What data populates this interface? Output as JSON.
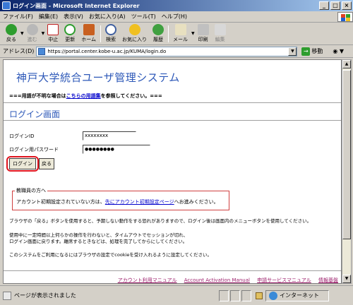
{
  "window": {
    "title": "ログイン画面 - Microsoft Internet Explorer"
  },
  "menu": [
    "ファイル(F)",
    "編集(E)",
    "表示(V)",
    "お気に入り(A)",
    "ツール(T)",
    "ヘルプ(H)"
  ],
  "toolbar": {
    "back": "戻る",
    "forward": "進む",
    "stop": "中止",
    "refresh": "更新",
    "home": "ホーム",
    "search": "検索",
    "favorites": "お気に入り",
    "history": "履歴",
    "mail": "メール",
    "print": "印刷",
    "edit": "編集"
  },
  "address": {
    "label": "アドレス(D)",
    "url": "https://portal.center.kobe-u.ac.jp/KUMA/login.do",
    "go": "移動"
  },
  "page": {
    "system_title": "神戸大学統合ユーザ管理システム",
    "notice_prefix": "===用語が不明な場合は",
    "notice_link": "こちらの用語集",
    "notice_suffix": "を参照してください。===",
    "login_heading": "ログイン画面",
    "login_id_label": "ログインID",
    "login_id_value": "xxxxxxxx",
    "password_label": "ログイン用パスワード",
    "password_value": "●●●●●●●●",
    "login_button": "ログイン",
    "back_button": "戻る",
    "faculty_legend": "教職員の方へ",
    "faculty_text_prefix": "アカウント初期設定されていない方は、",
    "faculty_link": "先にアカウント初期設定ページ",
    "faculty_text_suffix": "へお進みください。",
    "para1": "ブラウザの「戻る」ボタンを使用すると、予期しない動作をする恐れがありますので、ログイン後は画面内のメニューボタンを使用してください。",
    "para2_line1": "使用中に一定時間以上何らかの操作を行わないと、タイムアウトでセッションが切れ、",
    "para2_line2": "ログイン画面に戻ります。離席するときなどは、処理を完了してからにしてください。",
    "para3": "このシステムをご利用になるにはブラウザの設定でcookieを受け入れるように設定してください。",
    "footer_links": [
      "アカウント利用マニュアル",
      "Account Activation Manual",
      "申請サービスマニュアル",
      "情報基盤"
    ]
  },
  "status": {
    "text": "ページが表示されました",
    "zone": "インターネット"
  }
}
